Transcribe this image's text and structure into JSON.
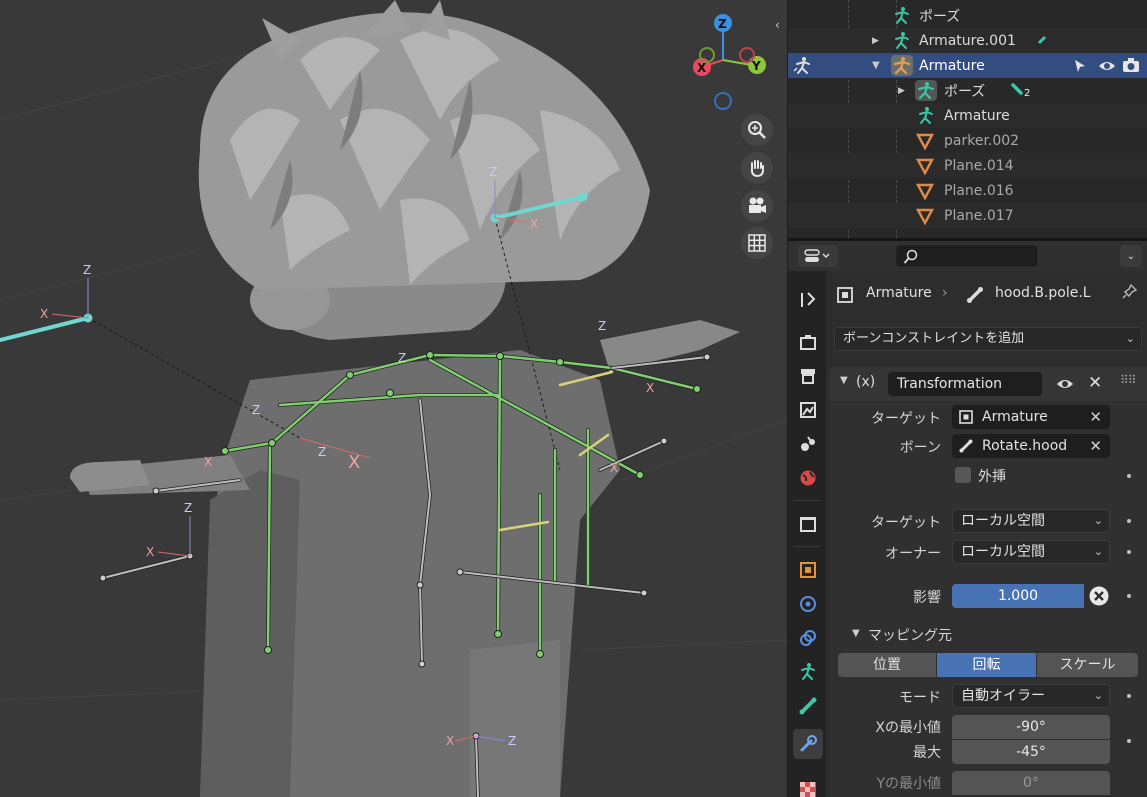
{
  "viewport": {
    "gizmo": {
      "z": "Z",
      "x": "X",
      "y": "Y"
    },
    "tools": [
      "zoom-icon",
      "hand-icon",
      "camera-icon",
      "grid-icon"
    ],
    "axis_labels": {
      "x": "X",
      "z": "Z"
    }
  },
  "outliner": {
    "rows": [
      {
        "label": "ポーズ",
        "icon": "pose-icon"
      },
      {
        "label": "Armature.001",
        "icon": "armature-icon"
      },
      {
        "label": "Armature",
        "icon": "armature-icon",
        "selected": true
      },
      {
        "label": "ポーズ",
        "icon": "pose-icon",
        "badge": "2"
      },
      {
        "label": "Armature",
        "icon": "armature-data-icon"
      },
      {
        "label": "parker.002",
        "icon": "mesh-icon"
      },
      {
        "label": "Plane.014",
        "icon": "mesh-icon"
      },
      {
        "label": "Plane.016",
        "icon": "mesh-icon"
      },
      {
        "label": "Plane.017",
        "icon": "mesh-icon"
      }
    ]
  },
  "properties": {
    "breadcrumb": {
      "object": "Armature",
      "bone": "hood.B.pole.L"
    },
    "add_constraint": "ボーンコンストレイントを追加",
    "constraint": {
      "type_symbol": "(x)",
      "name": "Transformation",
      "target_label": "ターゲット",
      "target_value": "Armature",
      "bone_label": "ボーン",
      "bone_value": "Rotate.hood",
      "extrapolate_label": "外挿",
      "target_space_label": "ターゲット",
      "target_space_value": "ローカル空間",
      "owner_space_label": "オーナー",
      "owner_space_value": "ローカル空間",
      "influence_label": "影響",
      "influence_value": "1.000",
      "influence": 1.0,
      "mapping_from": "マッピング元",
      "map_tabs": [
        "位置",
        "回転",
        "スケール"
      ],
      "map_active": "回転",
      "mode_label": "モード",
      "mode_value": "自動オイラー",
      "x_min_label": "Xの最小値",
      "x_min_value": "-90°",
      "x_max_label": "最大",
      "x_max_value": "-45°",
      "y_min_label": "Yの最小値",
      "y_min_value": "0°"
    }
  },
  "colors": {
    "selection": "#334d80",
    "accent_blue": "#4772b3",
    "bone_green": "#7fcf6f",
    "active_bone": "#6fd6d0",
    "axis_x": "#e84a5f",
    "axis_y": "#8cc63f",
    "axis_z": "#3d8fe0"
  }
}
